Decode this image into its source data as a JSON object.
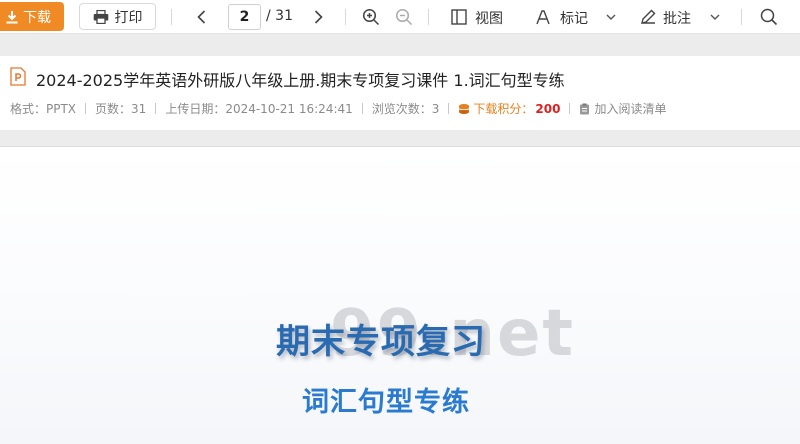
{
  "toolbar": {
    "download_label": "下载",
    "print_label": "打印",
    "page_current": "2",
    "page_total": "/ 31",
    "view_label": "视图",
    "mark_label": "标记",
    "annotate_label": "批注",
    "accent_color": "#f08a24"
  },
  "doc": {
    "title": "2024-2025学年英语外研版八年级上册.期末专项复习课件 1.词汇句型专练",
    "meta": {
      "format": "格式：PPTX",
      "pages": "页数：31",
      "upload_date": "上传日期：2024-10-21 16:24:41",
      "views": "浏览次数：3",
      "download_points_label": "下载积分：",
      "download_points_value": "200",
      "add_to_list": "加入阅读清单"
    }
  },
  "slide": {
    "watermark": "99.net",
    "title": "期末专项复习",
    "subtitle": "词汇句型专练"
  }
}
